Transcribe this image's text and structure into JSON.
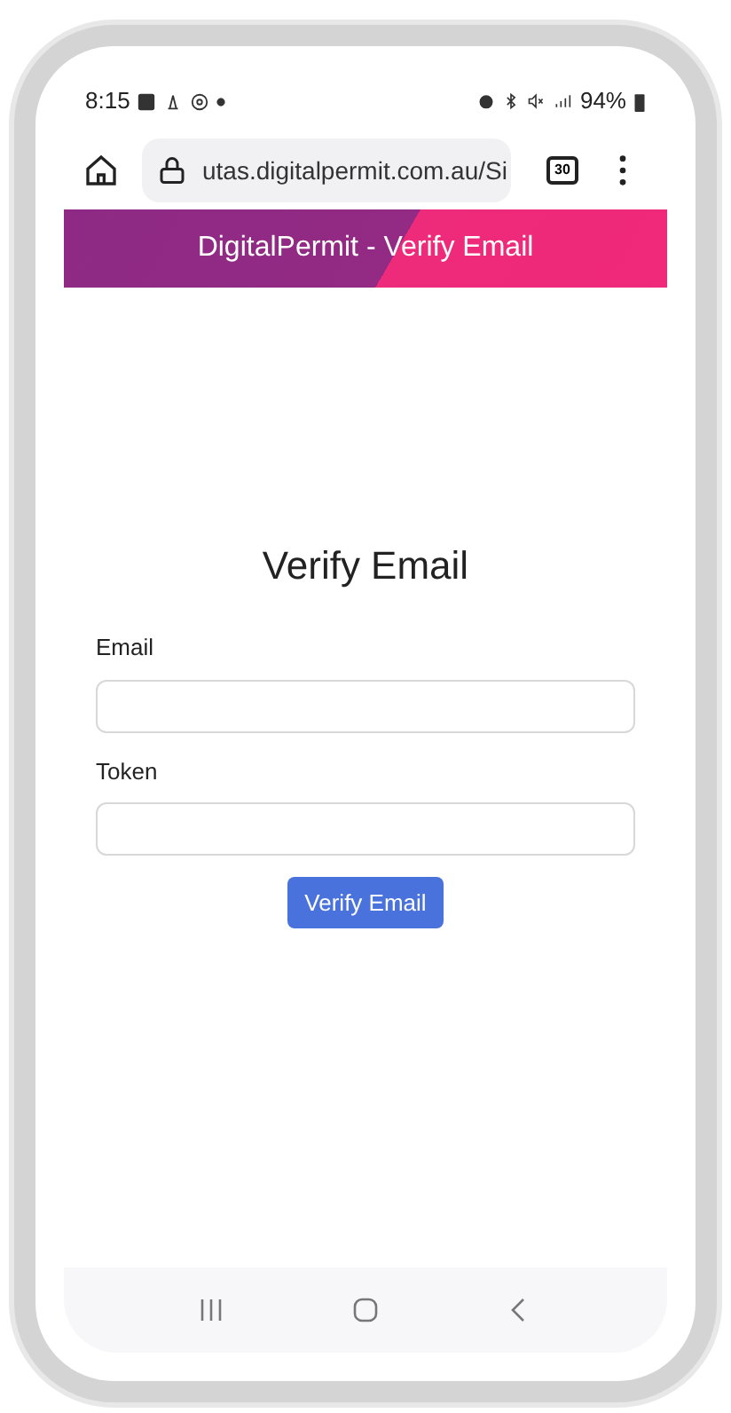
{
  "status_bar": {
    "time": "8:15",
    "battery": "94%"
  },
  "browser": {
    "url": "utas.digitalpermit.com.au/Si",
    "tab_count": "30"
  },
  "header": {
    "title": "DigitalPermit - Verify Email"
  },
  "form": {
    "title": "Verify Email",
    "fields": [
      {
        "label": "Email"
      },
      {
        "label": "Token"
      }
    ],
    "submit": "Verify Email"
  }
}
